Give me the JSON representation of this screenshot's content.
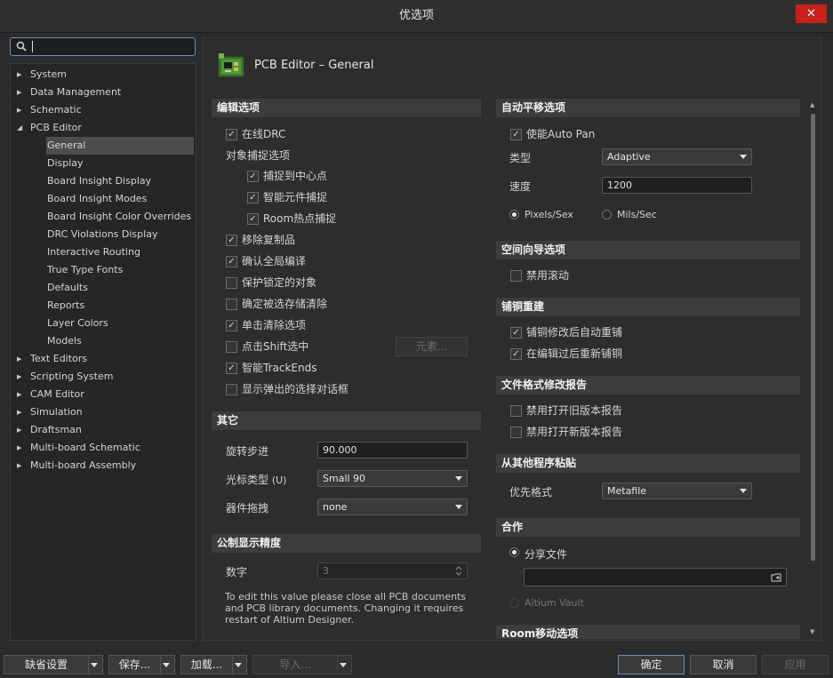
{
  "window": {
    "title": "优选项"
  },
  "search": {
    "value": ""
  },
  "tree": [
    {
      "label": "System",
      "level": 0,
      "expanded": false
    },
    {
      "label": "Data Management",
      "level": 0,
      "expanded": false
    },
    {
      "label": "Schematic",
      "level": 0,
      "expanded": false
    },
    {
      "label": "PCB Editor",
      "level": 0,
      "expanded": true
    },
    {
      "label": "General",
      "level": 1,
      "selected": true
    },
    {
      "label": "Display",
      "level": 1
    },
    {
      "label": "Board Insight Display",
      "level": 1
    },
    {
      "label": "Board Insight Modes",
      "level": 1
    },
    {
      "label": "Board Insight Color Overrides",
      "level": 1
    },
    {
      "label": "DRC Violations Display",
      "level": 1
    },
    {
      "label": "Interactive Routing",
      "level": 1
    },
    {
      "label": "True Type Fonts",
      "level": 1
    },
    {
      "label": "Defaults",
      "level": 1
    },
    {
      "label": "Reports",
      "level": 1
    },
    {
      "label": "Layer Colors",
      "level": 1
    },
    {
      "label": "Models",
      "level": 1
    },
    {
      "label": "Text Editors",
      "level": 0,
      "expanded": false
    },
    {
      "label": "Scripting System",
      "level": 0,
      "expanded": false
    },
    {
      "label": "CAM Editor",
      "level": 0,
      "expanded": false
    },
    {
      "label": "Simulation",
      "level": 0,
      "expanded": false
    },
    {
      "label": "Draftsman",
      "level": 0,
      "expanded": false
    },
    {
      "label": "Multi-board Schematic",
      "level": 0,
      "expanded": false
    },
    {
      "label": "Multi-board Assembly",
      "level": 0,
      "expanded": false
    }
  ],
  "page": {
    "title": "PCB Editor – General"
  },
  "edit": {
    "header": "编辑选项",
    "online_drc": {
      "label": "在线DRC",
      "checked": true
    },
    "snap_label": "对象捕捉选项",
    "snap_center": {
      "label": "捕捉到中心点",
      "checked": true
    },
    "smart_component": {
      "label": "智能元件捕捉",
      "checked": true
    },
    "room_hotspot": {
      "label": "Room热点捕捉",
      "checked": true
    },
    "remove_duplicates": {
      "label": "移除复制品",
      "checked": true
    },
    "confirm_global": {
      "label": "确认全局编译",
      "checked": true
    },
    "protect_locked": {
      "label": "保护锁定的对象",
      "checked": false
    },
    "confirm_clear": {
      "label": "确定被选存储清除",
      "checked": false
    },
    "click_clear": {
      "label": "单击清除选项",
      "checked": true
    },
    "shift_select": {
      "label": "点击Shift选中",
      "checked": false
    },
    "elements_button": "元素...",
    "smart_trackends": {
      "label": "智能TrackEnds",
      "checked": true
    },
    "show_popup": {
      "label": "显示弹出的选择对话框",
      "checked": false
    }
  },
  "other": {
    "header": "其它",
    "rotation_label": "旋转步进",
    "rotation_value": "90.000",
    "cursor_label": "光标类型",
    "cursor_shortcut": "(U)",
    "cursor_value": "Small 90",
    "drag_label": "器件拖拽",
    "drag_value": "none"
  },
  "metric": {
    "header": "公制显示精度",
    "digits_label": "数字",
    "digits_value": "3",
    "note": "To edit this value please close all PCB documents and PCB library documents. Changing it requires restart of Altium Designer."
  },
  "autopan": {
    "header": "自动平移选项",
    "enable": {
      "label": "使能Auto Pan",
      "checked": true
    },
    "type_label": "类型",
    "type_value": "Adaptive",
    "speed_label": "速度",
    "speed_value": "1200",
    "pixels": {
      "label": "Pixels/Sex",
      "selected": true
    },
    "mils": {
      "label": "Mils/Sec",
      "selected": false
    }
  },
  "spaceNav": {
    "header": "空间向导选项",
    "disable_roll": {
      "label": "禁用滚动",
      "checked": false
    }
  },
  "pour": {
    "header": "铺铜重建",
    "auto_repour": {
      "label": "铺铜修改后自动重铺",
      "checked": true
    },
    "repour_after_edit": {
      "label": "在编辑过后重新铺铜",
      "checked": true
    }
  },
  "fileFormat": {
    "header": "文件格式修改报告",
    "disable_old": {
      "label": "禁用打开旧版本报告",
      "checked": false
    },
    "disable_new": {
      "label": "禁用打开新版本报告",
      "checked": false
    }
  },
  "paste": {
    "header": "从其他程序粘贴",
    "format_label": "优先格式",
    "format_value": "Metafile"
  },
  "collab": {
    "header": "合作",
    "share_file": {
      "label": "分享文件",
      "selected": true
    },
    "path_value": "",
    "vault": {
      "label": "Altium Vault",
      "selected": false
    }
  },
  "room": {
    "header": "Room移动选项"
  },
  "footer": {
    "defaults": "缺省设置",
    "save": "保存...",
    "load": "加载...",
    "import": "导入...",
    "ok": "确定",
    "cancel": "取消",
    "apply": "应用"
  }
}
